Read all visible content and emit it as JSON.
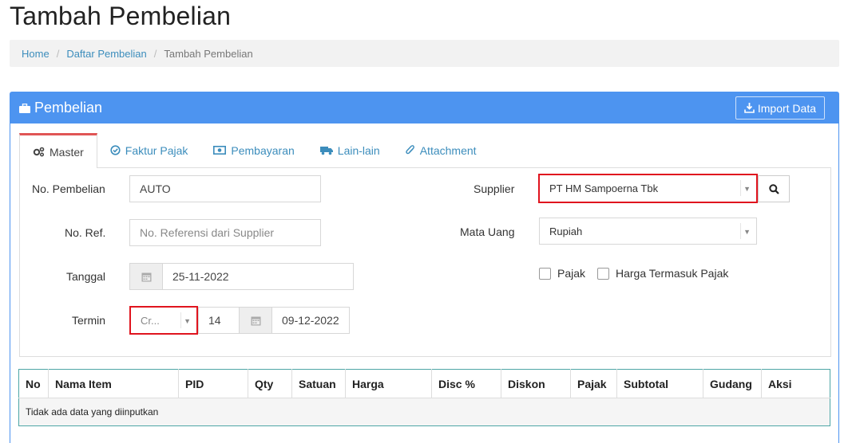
{
  "page": {
    "title": "Tambah Pembelian"
  },
  "breadcrumb": {
    "home": "Home",
    "list": "Daftar Pembelian",
    "current": "Tambah Pembelian"
  },
  "panel": {
    "title": "Pembelian",
    "import_label": "Import Data"
  },
  "tabs": [
    {
      "label": "Master",
      "icon": "cogs-icon"
    },
    {
      "label": "Faktur Pajak",
      "icon": "check-circle-icon"
    },
    {
      "label": "Pembayaran",
      "icon": "money-icon"
    },
    {
      "label": "Lain-lain",
      "icon": "truck-icon"
    },
    {
      "label": "Attachment",
      "icon": "paperclip-icon"
    }
  ],
  "form": {
    "no_pembelian": {
      "label": "No. Pembelian",
      "value": "AUTO"
    },
    "no_ref": {
      "label": "No. Ref.",
      "placeholder": "No. Referensi dari Supplier"
    },
    "tanggal": {
      "label": "Tanggal",
      "value": "25-11-2022"
    },
    "termin": {
      "label": "Termin",
      "type_value": "Cr...",
      "days": "14",
      "due_date": "09-12-2022"
    },
    "supplier": {
      "label": "Supplier",
      "value": "PT HM Sampoerna Tbk"
    },
    "mata_uang": {
      "label": "Mata Uang",
      "value": "Rupiah"
    },
    "pajak": {
      "label": "Pajak"
    },
    "harga_termasuk_pajak": {
      "label": "Harga Termasuk Pajak"
    }
  },
  "table": {
    "columns": [
      "No",
      "Nama Item",
      "PID",
      "Qty",
      "Satuan",
      "Harga",
      "Disc %",
      "Diskon",
      "Pajak",
      "Subtotal",
      "Gudang",
      "Aksi"
    ],
    "empty_text": "Tidak ada data yang diinputkan"
  },
  "colors": {
    "primary": "#4d94f0",
    "link": "#3c8dbc",
    "highlight": "#e0141e",
    "active_tab": "#e05555"
  }
}
